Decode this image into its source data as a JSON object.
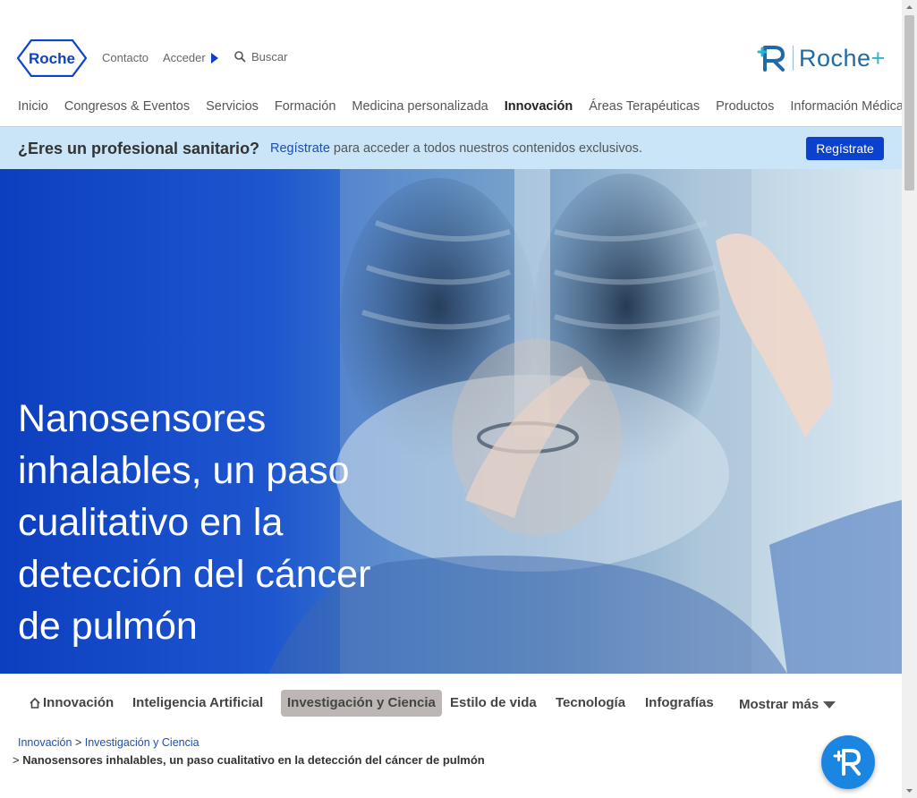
{
  "header": {
    "logo_text": "Roche",
    "contact_label": "Contacto",
    "login_label": "Acceder",
    "search_label": "Buscar",
    "brand_label": "Roche",
    "brand_plus": "+"
  },
  "nav": {
    "items": [
      {
        "label": "Inicio"
      },
      {
        "label": "Congresos & Eventos"
      },
      {
        "label": "Servicios"
      },
      {
        "label": "Formación"
      },
      {
        "label": "Medicina personalizada"
      },
      {
        "label": "Innovación"
      },
      {
        "label": "Áreas Terapéuticas"
      },
      {
        "label": "Productos"
      },
      {
        "label": "Información Médica"
      }
    ],
    "active_index": 5
  },
  "banner": {
    "question": "¿Eres un profesional sanitario?",
    "link": "Regístrate",
    "text": " para acceder a todos nuestros contenidos exclusivos.",
    "button": "Regístrate"
  },
  "hero": {
    "title": "Nanosensores inhalables, un paso cualitativo en la detección del cáncer de pulmón"
  },
  "subnav": {
    "items": [
      {
        "label": "Innovación"
      },
      {
        "label": "Inteligencia Artificial"
      },
      {
        "label": "Investigación y Ciencia"
      },
      {
        "label": "Estilo de vida"
      },
      {
        "label": "Tecnología"
      },
      {
        "label": "Infografías"
      }
    ],
    "more": "Mostrar más"
  },
  "breadcrumb": {
    "items": [
      "Innovación",
      "Investigación y Ciencia"
    ],
    "separator": ">",
    "current": "Nanosensores inhalables, un paso cualitativo en la detección del cáncer de pulmón"
  },
  "colors": {
    "primary_blue": "#0b41cd",
    "banner_bg": "#c9e5f7",
    "active_tab_bg": "#bcb7b4",
    "fab_bg": "#1b86e2"
  }
}
